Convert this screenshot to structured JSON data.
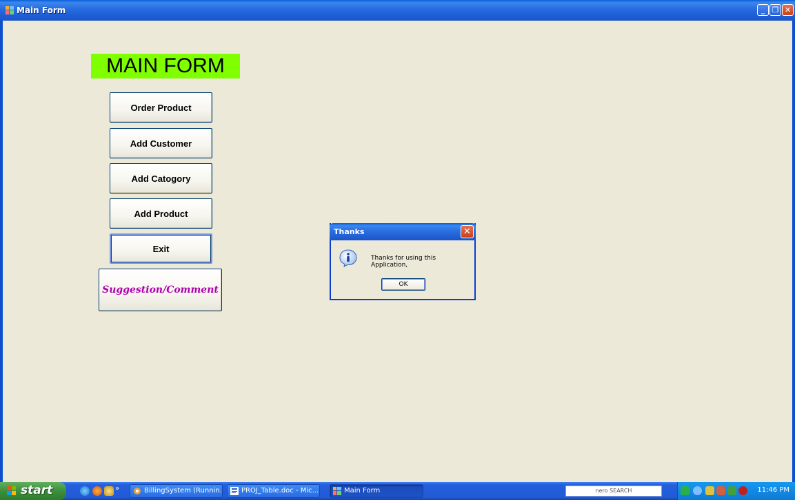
{
  "window": {
    "title": "Main Form",
    "controls": {
      "minimize": "_",
      "maximize": "❐",
      "close": "✕"
    }
  },
  "form": {
    "heading": "MAIN FORM",
    "buttons": {
      "order_product": "Order Product",
      "add_customer": "Add Customer",
      "add_category": "Add Catogory",
      "add_product": "Add Product",
      "exit": "Exit",
      "suggestion": "Suggestion/Comment"
    },
    "heading_bg": "#80ff00",
    "suggestion_color": "#b000b0"
  },
  "dialog": {
    "title": "Thanks",
    "message": "Thanks for using this Application,",
    "ok_label": "OK",
    "icon": "info-icon",
    "close": "✕"
  },
  "taskbar": {
    "start_label": "start",
    "quick_launch": [
      "ie-icon",
      "firefox-icon",
      "desktop-icon"
    ],
    "chevron": "»",
    "tasks": [
      {
        "label": "BillingSystem (Runnin...",
        "icon": "vs-icon"
      },
      {
        "label": "PROJ_Table.doc - Mic...",
        "icon": "word-icon"
      },
      {
        "label": "Main Form",
        "icon": "app-icon"
      }
    ],
    "search_label": "nero SEARCH",
    "clock": "11:46 PM"
  }
}
